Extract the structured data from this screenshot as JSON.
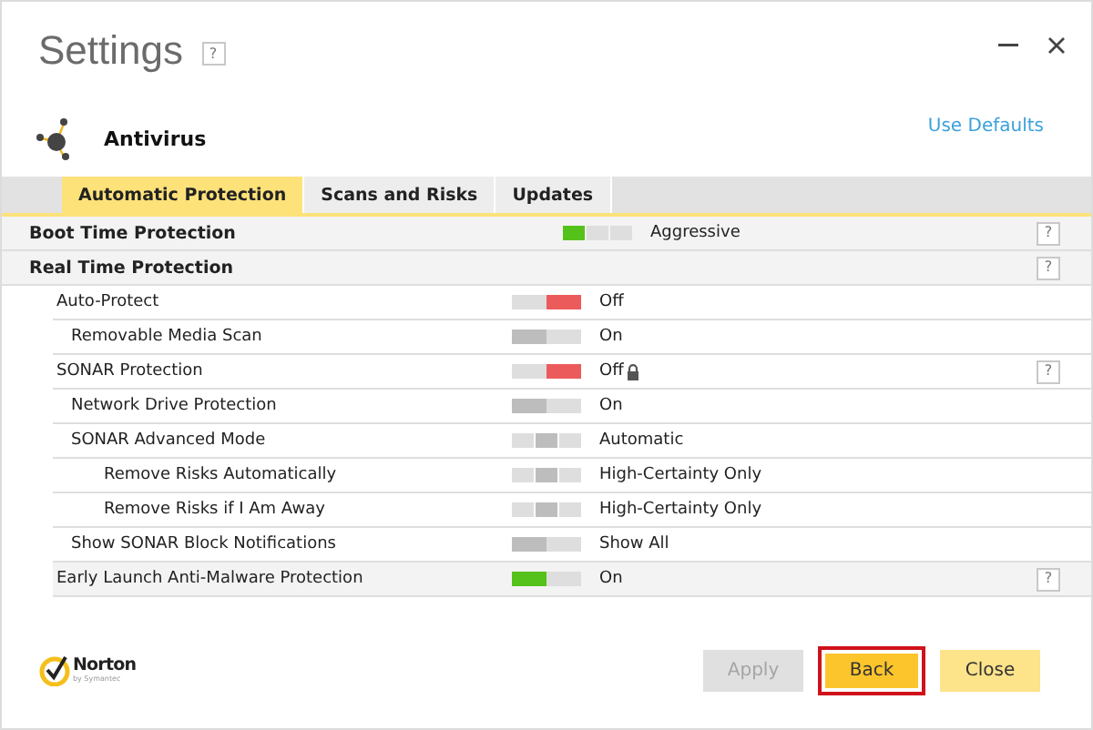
{
  "window": {
    "title": "Settings",
    "help": "?"
  },
  "header": {
    "title": "Antivirus",
    "link": "Use Defaults"
  },
  "tabs": [
    {
      "label": "Automatic Protection",
      "selected": true
    },
    {
      "label": "Scans and Risks",
      "selected": false
    },
    {
      "label": "Updates",
      "selected": false
    }
  ],
  "rows": [
    {
      "label": "Boot Time Protection",
      "kind": "section",
      "switch": {
        "color": "#55c21b",
        "segments": [
          {
            "selected": true
          },
          {
            "selected": false
          },
          {
            "selected": false
          }
        ]
      },
      "value": "Aggressive",
      "locked": false,
      "help": "?"
    },
    {
      "label": "Real Time Protection",
      "kind": "section",
      "help": "?",
      "children": [
        {
          "label": "Auto-Protect",
          "kind": "setting",
          "switch": {
            "color": "#ec5b5b",
            "segments": [
              {
                "selected": false
              },
              {
                "selected": true
              }
            ]
          },
          "value": "Off",
          "locked": false,
          "children": [
            {
              "label": "Removable Media Scan",
              "kind": "setting",
              "switch": {
                "color": "#bdbdbd",
                "segments": [
                  {
                    "selected": true
                  },
                  {
                    "selected": false
                  }
                ]
              },
              "value": "On",
              "locked": false
            }
          ]
        },
        {
          "label": "SONAR Protection",
          "kind": "setting",
          "switch": {
            "color": "#ec5b5b",
            "segments": [
              {
                "selected": false
              },
              {
                "selected": true
              }
            ]
          },
          "value": "Off",
          "locked": true,
          "help": "?",
          "children": [
            {
              "label": "Network Drive Protection",
              "kind": "setting",
              "switch": {
                "color": "#bdbdbd",
                "segments": [
                  {
                    "selected": true
                  },
                  {
                    "selected": false
                  }
                ]
              },
              "value": "On",
              "locked": false
            },
            {
              "label": "SONAR Advanced Mode",
              "kind": "setting",
              "switch": {
                "color": "#bdbdbd",
                "segments": [
                  {
                    "selected": false
                  },
                  {
                    "selected": true
                  },
                  {
                    "selected": false
                  }
                ]
              },
              "value": "Automatic",
              "locked": false,
              "children": [
                {
                  "label": "Remove Risks Automatically",
                  "kind": "setting",
                  "switch": {
                    "color": "#bdbdbd",
                    "segments": [
                      {
                        "selected": false
                      },
                      {
                        "selected": true
                      },
                      {
                        "selected": false
                      }
                    ]
                  },
                  "value": "High-Certainty Only",
                  "locked": false
                },
                {
                  "label": "Remove Risks if I Am Away",
                  "kind": "setting",
                  "switch": {
                    "color": "#bdbdbd",
                    "segments": [
                      {
                        "selected": false
                      },
                      {
                        "selected": true
                      },
                      {
                        "selected": false
                      }
                    ]
                  },
                  "value": "High-Certainty Only",
                  "locked": false
                }
              ]
            },
            {
              "label": "Show SONAR Block Notifications",
              "kind": "setting",
              "switch": {
                "color": "#bdbdbd",
                "segments": [
                  {
                    "selected": true
                  },
                  {
                    "selected": false
                  }
                ]
              },
              "value": "Show All",
              "locked": false
            }
          ]
        },
        {
          "label": "Early Launch Anti-Malware Protection",
          "kind": "shaded",
          "switch": {
            "color": "#55c21b",
            "segments": [
              {
                "selected": true
              },
              {
                "selected": false
              }
            ]
          },
          "value": "On",
          "locked": false,
          "help": "?"
        }
      ]
    }
  ],
  "footer": {
    "logo": {
      "name": "Norton",
      "tagline": "by Symantec"
    },
    "buttons": [
      {
        "label": "Apply",
        "kind": "disabled",
        "focused": false
      },
      {
        "label": "Back",
        "kind": "primary",
        "focused": true
      },
      {
        "label": "Close",
        "kind": "secondary",
        "focused": false
      }
    ]
  }
}
